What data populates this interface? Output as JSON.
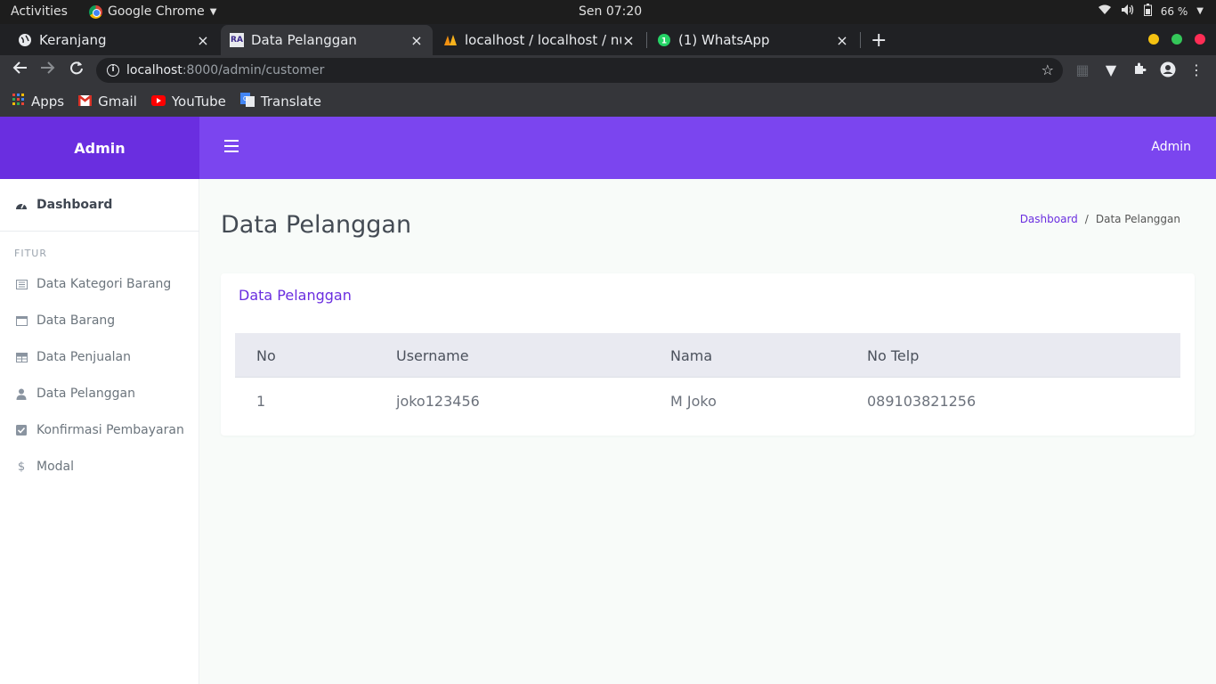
{
  "os_bar": {
    "activities": "Activities",
    "app_name": "Google Chrome",
    "clock": "Sen 07:20",
    "battery": "66 %"
  },
  "tabs": [
    {
      "title": "Keranjang",
      "close": "×"
    },
    {
      "title": "Data Pelanggan",
      "favicon_text": "RA",
      "close": "×"
    },
    {
      "title": "localhost / localhost / nus",
      "close": "×"
    },
    {
      "title": "(1) WhatsApp",
      "close": "×"
    }
  ],
  "new_tab": "+",
  "address": {
    "host": "localhost",
    "path": ":8000/admin/customer"
  },
  "bookmarks": [
    {
      "label": "Apps"
    },
    {
      "label": "Gmail"
    },
    {
      "label": "YouTube"
    },
    {
      "label": "Translate"
    }
  ],
  "admin": {
    "brand": "Admin",
    "user": "Admin"
  },
  "sidebar": {
    "dashboard": "Dashboard",
    "section": "FITUR",
    "items": [
      {
        "label": "Data Kategori Barang"
      },
      {
        "label": "Data Barang"
      },
      {
        "label": "Data Penjualan"
      },
      {
        "label": "Data Pelanggan"
      },
      {
        "label": "Konfirmasi Pembayaran"
      },
      {
        "label": "Modal"
      }
    ]
  },
  "page": {
    "title": "Data Pelanggan",
    "breadcrumb": {
      "home": "Dashboard",
      "sep": "/",
      "current": "Data Pelanggan"
    }
  },
  "card": {
    "title": "Data Pelanggan",
    "columns": [
      "No",
      "Username",
      "Nama",
      "No Telp"
    ],
    "rows": [
      [
        "1",
        "joko123456",
        "M Joko",
        "089103821256"
      ]
    ]
  },
  "colors": {
    "brand": "#6a2ee0",
    "header": "#7b45ef"
  }
}
